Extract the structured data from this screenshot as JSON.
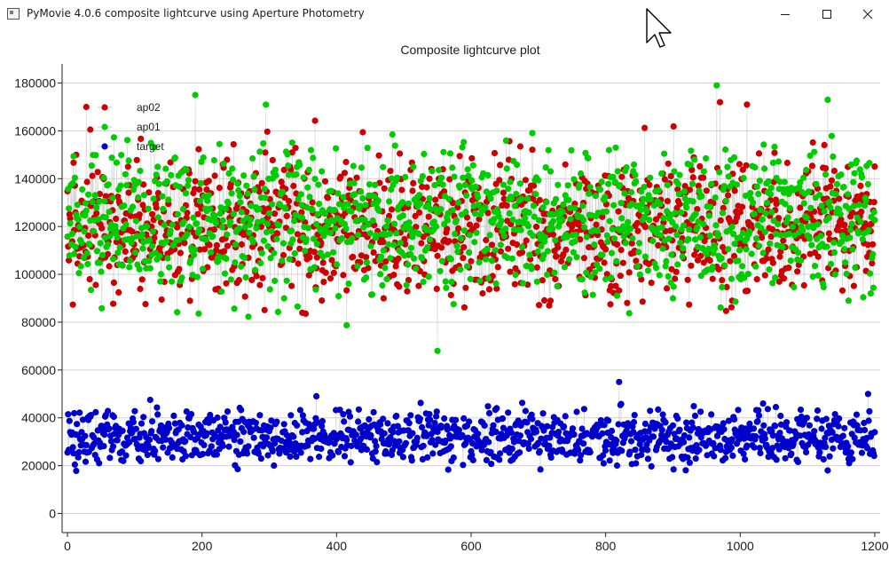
{
  "window": {
    "title": "PyMovie 4.0.6 composite lightcurve using Aperture Photometry"
  },
  "plot": {
    "title": "Composite lightcurve plot"
  },
  "colors": {
    "ap02": "#cc0000",
    "ap01": "#00cc00",
    "target": "#0000cc",
    "connector": "#c8c8c8",
    "grid": "#d2d2d2"
  },
  "chart_data": {
    "type": "scatter",
    "title": "Composite lightcurve plot",
    "xlabel": "",
    "ylabel": "",
    "xlim": [
      -8,
      1208
    ],
    "ylim": [
      -8000,
      188000
    ],
    "x_ticks": [
      "0",
      "200",
      "400",
      "600",
      "800",
      "1000",
      "1200"
    ],
    "y_ticks": [
      "0",
      "20000",
      "40000",
      "60000",
      "80000",
      "100000",
      "120000",
      "140000",
      "160000",
      "180000"
    ],
    "grid": "horizontal",
    "legend": {
      "placement": "top-left",
      "entries": [
        "ap02",
        "ap01",
        "target"
      ]
    },
    "series": [
      {
        "name": "ap02",
        "x_range": [
          0,
          1200
        ],
        "points": 1201,
        "mean": 120000,
        "spread": 15000,
        "min": 83000,
        "max": 172000,
        "notable": [
          [
            28,
            170000
          ],
          [
            90,
            145000
          ],
          [
            970,
            172000
          ],
          [
            1010,
            171000
          ]
        ]
      },
      {
        "name": "ap01",
        "x_range": [
          0,
          1200
        ],
        "points": 1201,
        "mean": 122000,
        "spread": 15000,
        "min": 68000,
        "max": 179000,
        "notable": [
          [
            190,
            175000
          ],
          [
            295,
            171000
          ],
          [
            550,
            68000
          ],
          [
            965,
            179000
          ],
          [
            1130,
            173000
          ]
        ]
      },
      {
        "name": "target",
        "x_range": [
          0,
          1200
        ],
        "points": 1201,
        "mean": 32000,
        "spread": 5500,
        "min": 17000,
        "max": 55000,
        "notable": [
          [
            123,
            47500
          ],
          [
            370,
            49000
          ],
          [
            820,
            55000
          ],
          [
            1190,
            50000
          ]
        ]
      }
    ]
  }
}
